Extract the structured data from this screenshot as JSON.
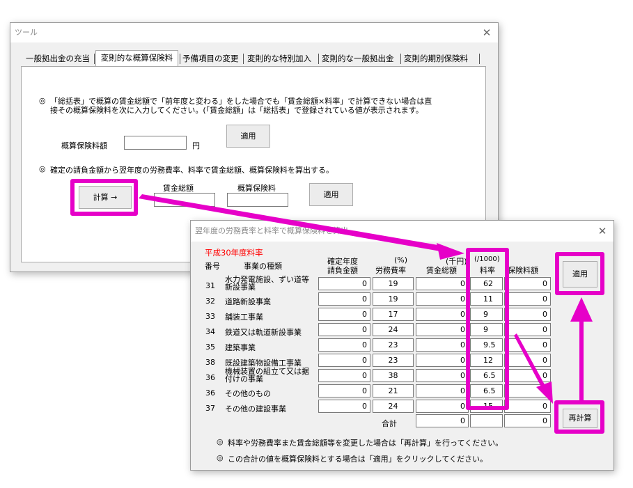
{
  "main_window": {
    "title": "ツール",
    "close_glyph": "✕",
    "tabs": [
      "一般拠出金の充当",
      "変則的な概算保険料",
      "予備項目の変更",
      "変則的な特別加入",
      "変則的な一般拠出金",
      "変則的期別保険料"
    ],
    "note1_mark": "◎",
    "note1_line1": "「総括表」で概算の賃金総額で「前年度と変わる」をした場合でも「賃金総額×料率」で計算できない場合は直",
    "note1_line2": "接その概算保険料を次に入力してください。(「賃金総額」は「総括表」で登録されている値が表示されます。",
    "premium_label": "概算保険料額",
    "premium_value": "",
    "yen_unit": "円",
    "apply1_label": "適用",
    "note2_mark": "◎",
    "note2_text": "確定の請負金額から翌年度の労務費率、料率で賃金総額、概算保険料を算出する。",
    "calc_button_label": "計算 →",
    "wage_total_label": "賃金総額",
    "estimated_premium_label": "概算保険料",
    "apply2_label": "適用"
  },
  "dialog": {
    "title": "翌年度の労務費率と料率で概算保険料を算出",
    "close_glyph": "✕",
    "year_rate_label": "平成30年度料率",
    "headers": {
      "no": "番号",
      "type": "事業の種類",
      "contract_line1": "確定年度",
      "contract_line2": "請負金額",
      "labor_unit": "(%)",
      "labor": "労務費率",
      "wage_unit": "(千円)",
      "wage": "賃金総額",
      "rate_unit": "(/1000)",
      "rate": "料率",
      "premium": "保険料額"
    },
    "rows": [
      {
        "no": "31",
        "type_line1": "水力発電施設、ずい道等",
        "type_line2": "新設事業",
        "contract": "0",
        "labor": "19",
        "wage": "0",
        "rate": "62",
        "premium": "0"
      },
      {
        "no": "32",
        "type_line1": "道路新設事業",
        "type_line2": "",
        "contract": "0",
        "labor": "19",
        "wage": "0",
        "rate": "11",
        "premium": "0"
      },
      {
        "no": "33",
        "type_line1": "舗装工事業",
        "type_line2": "",
        "contract": "0",
        "labor": "17",
        "wage": "0",
        "rate": "9",
        "premium": "0"
      },
      {
        "no": "34",
        "type_line1": "鉄道又は軌道新設事業",
        "type_line2": "",
        "contract": "0",
        "labor": "24",
        "wage": "0",
        "rate": "9",
        "premium": "0"
      },
      {
        "no": "35",
        "type_line1": "建築事業",
        "type_line2": "",
        "contract": "0",
        "labor": "23",
        "wage": "0",
        "rate": "9.5",
        "premium": "0"
      },
      {
        "no": "38",
        "type_line1": "既設建築物設備工事業",
        "type_line2": "",
        "contract": "0",
        "labor": "23",
        "wage": "0",
        "rate": "12",
        "premium": "0"
      },
      {
        "no": "36",
        "type_line1": "機械装置の組立て又は据",
        "type_line2": "付けの事業",
        "contract": "0",
        "labor": "38",
        "wage": "0",
        "rate": "6.5",
        "premium": "0"
      },
      {
        "no": "36",
        "type_line1": "その他のもの",
        "type_line2": "",
        "contract": "0",
        "labor": "21",
        "wage": "0",
        "rate": "6.5",
        "premium": "0"
      },
      {
        "no": "37",
        "type_line1": "その他の建設事業",
        "type_line2": "",
        "contract": "0",
        "labor": "24",
        "wage": "0",
        "rate": "15",
        "premium": "0"
      }
    ],
    "total_label": "合計",
    "total_wage": "0",
    "total_rate": "",
    "total_premium": "0",
    "apply_label": "適用",
    "recalc_label": "再計算",
    "note1_mark": "◎",
    "note1_text": "料率や労務費率また賃金総額等を変更した場合は「再計算」を行ってください。",
    "note2_mark": "◎",
    "note2_text": "この合計の値を概算保険料とする場合は「適用」をクリックしてください。"
  },
  "colors": {
    "highlight": "#e600c8",
    "year_rate_text": "#ff0000",
    "window_bg": "#f0f0f0"
  }
}
